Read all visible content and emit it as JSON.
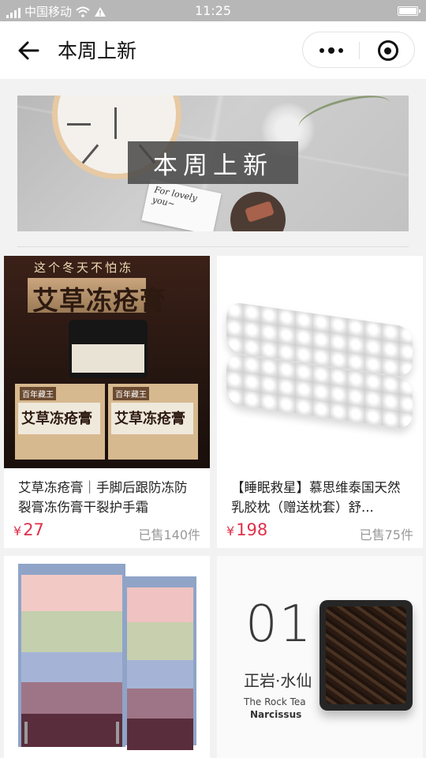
{
  "status_bar": {
    "carrier": "中国移动",
    "time": "11:25"
  },
  "nav": {
    "title": "本周上新"
  },
  "banner": {
    "title": "本周上新",
    "card_text": "For lovely\nyou~"
  },
  "products": [
    {
      "name": "艾草冻疮膏｜手脚后跟防冻防裂膏冻伤膏干裂护手霜",
      "currency": "¥",
      "price": "27",
      "sold": "已售140件",
      "image": {
        "top_slogan": "这个冬天不怕冻",
        "title": "艾草冻疮膏",
        "box_brand": "百年藏王",
        "box_label": "艾草冻疮膏"
      }
    },
    {
      "name": "【睡眠救星】慕思维泰国天然乳胶枕（赠送枕套）舒...",
      "currency": "¥",
      "price": "198",
      "sold": "已售75件"
    },
    {
      "name": "",
      "image": {}
    },
    {
      "name": "",
      "image": {
        "number": "01",
        "name_cn": "正岩·水仙",
        "name_en": "The Rock Tea",
        "name_en2": "Narcissus"
      }
    }
  ]
}
